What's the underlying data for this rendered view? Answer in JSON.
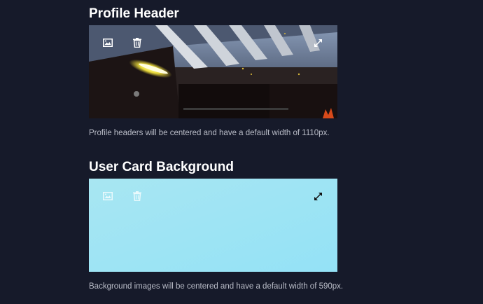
{
  "sections": [
    {
      "title": "Profile Header",
      "note": "Profile headers will be centered and have a default width of 1110px.",
      "icons": [
        "image-icon",
        "trash-icon",
        "expand-icon"
      ]
    },
    {
      "title": "User Card Background",
      "note": "Background images will be centered and have a default width of 590px.",
      "icons": [
        "image-icon",
        "trash-icon",
        "expand-icon"
      ]
    }
  ],
  "colors": {
    "page_background": "#161a2a",
    "title_text": "#ffffff",
    "note_text": "#b9bcc7",
    "card_background_fill": "#9fe3f3"
  }
}
